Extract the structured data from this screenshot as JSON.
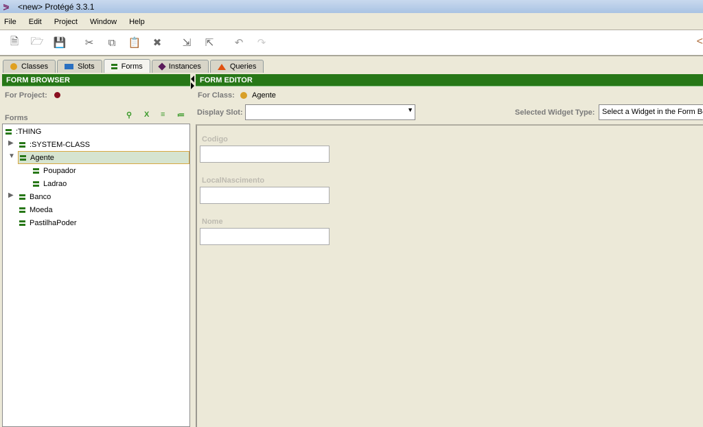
{
  "window": {
    "title": "<new>  Protégé 3.3.1"
  },
  "menu": [
    "File",
    "Edit",
    "Project",
    "Window",
    "Help"
  ],
  "toolbar": [
    {
      "icon": "new-file-icon"
    },
    {
      "icon": "open-folder-icon"
    },
    {
      "icon": "save-icon"
    },
    {
      "icon": "cut-icon"
    },
    {
      "icon": "copy-icon"
    },
    {
      "icon": "paste-icon"
    },
    {
      "icon": "delete-icon"
    },
    {
      "icon": "import-icon"
    },
    {
      "icon": "export-icon"
    },
    {
      "icon": "undo-icon"
    },
    {
      "icon": "redo-icon"
    }
  ],
  "tabs": [
    {
      "label": "Classes",
      "color": "#e0a020"
    },
    {
      "label": "Slots",
      "color": "#2a6fc0"
    },
    {
      "label": "Forms",
      "color": "#277717"
    },
    {
      "label": "Instances",
      "color": "#5a1a5a"
    },
    {
      "label": "Queries",
      "color": "#e05010"
    }
  ],
  "active_tab": "Forms",
  "form_browser": {
    "header": "FORM BROWSER",
    "for_project_label": "For Project:",
    "forms_label": "Forms",
    "tree": [
      {
        "label": ":THING",
        "level": 0,
        "expander": ""
      },
      {
        "label": ":SYSTEM-CLASS",
        "level": 1,
        "expander": "collapsed"
      },
      {
        "label": "Agente",
        "level": 1,
        "expander": "expanded",
        "selected": true
      },
      {
        "label": "Poupador",
        "level": 2,
        "expander": ""
      },
      {
        "label": "Ladrao",
        "level": 2,
        "expander": ""
      },
      {
        "label": "Banco",
        "level": 1,
        "expander": "collapsed"
      },
      {
        "label": "Moeda",
        "level": 1,
        "expander": ""
      },
      {
        "label": "PastilhaPoder",
        "level": 1,
        "expander": ""
      }
    ]
  },
  "form_editor": {
    "header": "FORM EDITOR",
    "for_class_label": "For Class:",
    "for_class_value": "Agente",
    "display_slot_label": "Display Slot:",
    "display_slot_value": "",
    "widget_type_label": "Selected Widget Type:",
    "widget_type_value": "Select a Widget in the Form Be",
    "fields": [
      {
        "label": "Codigo",
        "value": ""
      },
      {
        "label": "LocalNascimento",
        "value": ""
      },
      {
        "label": "Nome",
        "value": ""
      }
    ]
  },
  "colors": {
    "header_green": "#277717",
    "panel_bg": "#ece9d8",
    "selection": "#d6e4d0"
  }
}
